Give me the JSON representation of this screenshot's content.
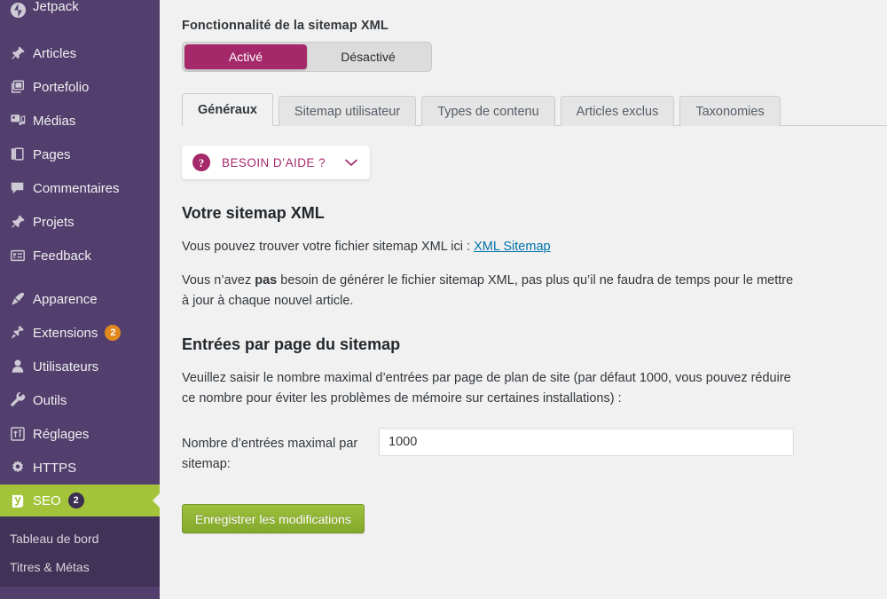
{
  "sidebar": {
    "items": [
      {
        "label": "Jetpack",
        "icon": "jetpack-icon",
        "badge": null,
        "active": false
      },
      {
        "label": "Articles",
        "icon": "pin-icon",
        "badge": null,
        "active": false
      },
      {
        "label": "Portefolio",
        "icon": "portfolio-icon",
        "badge": null,
        "active": false
      },
      {
        "label": "Médias",
        "icon": "media-icon",
        "badge": null,
        "active": false
      },
      {
        "label": "Pages",
        "icon": "pages-icon",
        "badge": null,
        "active": false
      },
      {
        "label": "Commentaires",
        "icon": "comment-icon",
        "badge": null,
        "active": false
      },
      {
        "label": "Projets",
        "icon": "pin-icon",
        "badge": null,
        "active": false
      },
      {
        "label": "Feedback",
        "icon": "feedback-icon",
        "badge": null,
        "active": false
      },
      {
        "label": "Apparence",
        "icon": "brush-icon",
        "badge": null,
        "active": false
      },
      {
        "label": "Extensions",
        "icon": "plugin-icon",
        "badge": "2",
        "active": false
      },
      {
        "label": "Utilisateurs",
        "icon": "user-icon",
        "badge": null,
        "active": false
      },
      {
        "label": "Outils",
        "icon": "wrench-icon",
        "badge": null,
        "active": false
      },
      {
        "label": "Réglages",
        "icon": "settings-sliders-icon",
        "badge": null,
        "active": false
      },
      {
        "label": "HTTPS",
        "icon": "gear-icon",
        "badge": null,
        "active": false
      },
      {
        "label": "SEO",
        "icon": "yoast-logo-icon",
        "badge": "2",
        "active": true
      }
    ],
    "submenu": [
      {
        "label": "Tableau de bord"
      },
      {
        "label": "Titres & Métas"
      }
    ],
    "colors": {
      "background": "#523f6d",
      "submenu_background": "#413257",
      "active_background": "#a3c43a",
      "badge_orange": "#e2891e",
      "badge_dark": "#3b2f52"
    }
  },
  "main": {
    "feature_title": "Fonctionnalité de la sitemap XML",
    "toggle": {
      "on_label": "Activé",
      "off_label": "Désactivé",
      "selected": "Activé",
      "on_color": "#a4286a"
    },
    "tabs": [
      {
        "label": "Généraux",
        "selected": true
      },
      {
        "label": "Sitemap utilisateur",
        "selected": false
      },
      {
        "label": "Types de contenu",
        "selected": false
      },
      {
        "label": "Articles exclus",
        "selected": false
      },
      {
        "label": "Taxonomies",
        "selected": false
      }
    ],
    "help": {
      "icon_glyph": "?",
      "label": "BESOIN D’AIDE ?",
      "chevron": "chevron-down-icon",
      "accent_color": "#a4286a"
    },
    "sitemap_section": {
      "heading": "Votre sitemap XML",
      "paragraph_1_prefix": "Vous pouvez trouver votre fichier sitemap XML ici : ",
      "paragraph_1_link": "XML Sitemap",
      "paragraph_2_part1": "Vous n’avez ",
      "paragraph_2_bold": "pas",
      "paragraph_2_part2": " besoin de générer le fichier sitemap XML, pas plus qu’il ne faudra de temps pour le mettre à jour à chaque nouvel article."
    },
    "entries_section": {
      "heading": "Entrées par page du sitemap",
      "description": "Veuillez saisir le nombre maximal d’entrées par page de plan de site (par défaut 1000, vous pouvez réduire ce nombre pour éviter les problèmes de mémoire sur certaines installations) :",
      "field_label": "Nombre d’entrées maximal par sitemap:",
      "field_value": "1000",
      "field_placeholder": "1000"
    },
    "save_label": "Enregistrer les modifications",
    "save_color": "#8cb332"
  }
}
